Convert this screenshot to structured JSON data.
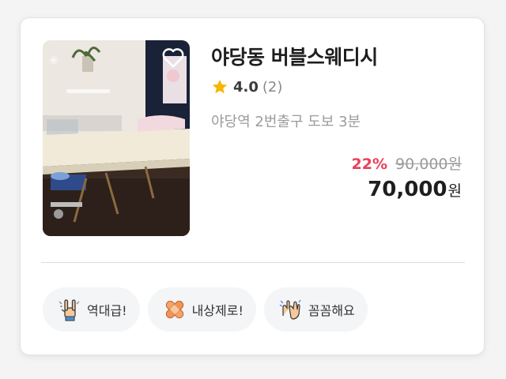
{
  "listing": {
    "title": "야당동 버블스웨디시",
    "rating": "4.0",
    "review_count": "(2)",
    "location": "야당역 2번출구 도보 3분",
    "discount": "22%",
    "original_price": "90,000원",
    "price": "70,000",
    "currency": "원",
    "thumbnail_icon": "massage-room-photo",
    "wishlist_icon": "heart-outline-icon"
  },
  "tags": [
    {
      "label": "역대급!",
      "icon": "rock-hand-icon"
    },
    {
      "label": "내상제로!",
      "icon": "bandage-icon"
    },
    {
      "label": "꼼꼼해요",
      "icon": "clapping-hands-icon"
    }
  ],
  "colors": {
    "discount": "#e8405a",
    "star": "#f7b500",
    "tag_bg": "#f3f5f7"
  }
}
